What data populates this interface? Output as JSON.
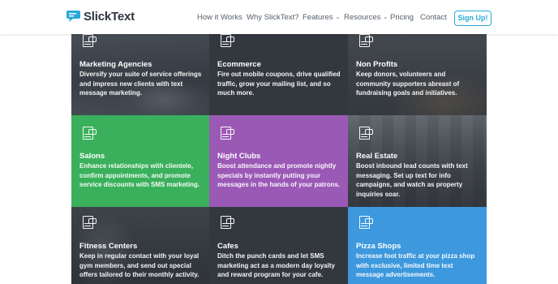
{
  "header": {
    "logo_text": "SlickText",
    "nav": [
      {
        "label": "How it Works",
        "caret": false
      },
      {
        "label": "Why SlickText?",
        "caret": false
      },
      {
        "label": "Features",
        "caret": true
      },
      {
        "label": "Resources",
        "caret": true
      },
      {
        "label": "Pricing",
        "caret": false
      },
      {
        "label": "Contact",
        "caret": false
      }
    ],
    "signup_label": "Sign Up!",
    "caret_glyph": "⌄"
  },
  "colors": {
    "accent": "#28a9d7",
    "green": "#3bb05c",
    "purple": "#9b59b6",
    "blue": "#3d98dd",
    "dark": "#32373f"
  },
  "tiles": [
    {
      "title": "Marketing Agencies",
      "desc": "Diversify your suite of service offerings and impress new clients with text message marketing.",
      "icon": "sms-page-icon"
    },
    {
      "title": "Ecommerce",
      "desc": "Fire out mobile coupons, drive qualified traffic, grow your mailing list, and so much more.",
      "icon": "sms-page-icon"
    },
    {
      "title": "Non Profits",
      "desc": "Keep donors, volunteers and community supporters abreast of fundraising goals and initiatives.",
      "icon": "sms-page-icon"
    },
    {
      "title": "Salons",
      "desc": "Enhance relationships with clientele, confirm appointments, and promote service discounts with SMS marketing.",
      "icon": "sms-page-icon"
    },
    {
      "title": "Night Clubs",
      "desc": "Boost attendance and promote nightly specials by instantly putting your messages in the hands of your patrons.",
      "icon": "sms-page-icon"
    },
    {
      "title": "Real Estate",
      "desc": "Boost inbound lead counts with text messaging. Set up text for info campaigns, and watch as property inquiries soar.",
      "icon": "sms-page-icon"
    },
    {
      "title": "Fitness Centers",
      "desc": "Keep in regular contact with your loyal gym members, and send out special offers tailored to their monthly activity.",
      "icon": "sms-page-icon"
    },
    {
      "title": "Cafes",
      "desc": "Ditch the punch cards and let SMS marketing act as a modern day loyalty and reward program for your cafe.",
      "icon": "sms-page-icon"
    },
    {
      "title": "Pizza Shops",
      "desc": "Increase foot traffic at your pizza shop with exclusive, limited time text message advertisements.",
      "icon": "sms-page-icon"
    }
  ]
}
